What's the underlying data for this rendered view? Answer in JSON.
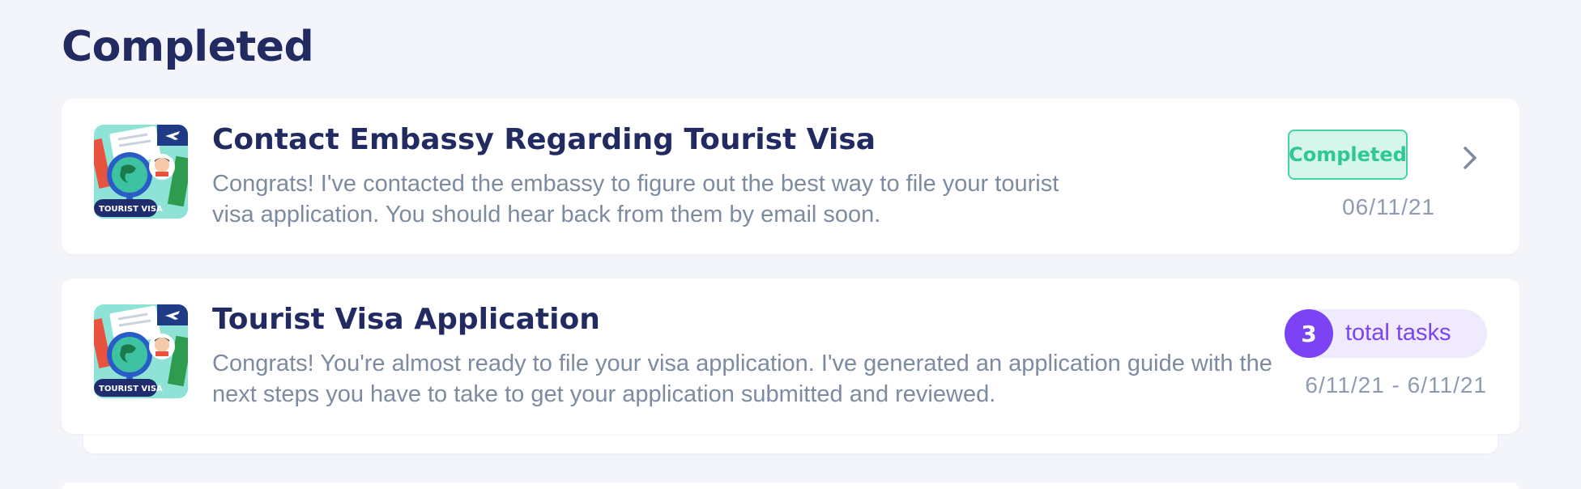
{
  "section": {
    "title": "Completed"
  },
  "cards": [
    {
      "thumbnail_text": "TOURIST VISA",
      "title": "Contact Embassy Regarding Tourist Visa",
      "description": "Congrats! I've contacted the embassy to figure out the best way to file your tourist visa application. You should hear back from them by email soon.",
      "status": "Completed",
      "date": "06/11/21",
      "icon": "chevron-right-icon"
    },
    {
      "thumbnail_text": "TOURIST VISA",
      "title": "Tourist Visa Application",
      "description": "Congrats! You're almost ready to file your visa application. I've generated an application guide with the next steps you have to take to get your application submitted and reviewed.",
      "task_count": "3",
      "task_label": "total tasks",
      "date_range": "6/11/21 - 6/11/21"
    }
  ],
  "colors": {
    "heading": "#222b61",
    "body_text": "#7d8ba0",
    "completed_green": "#2ec796",
    "accent_purple": "#7b43f3",
    "background": "#f3f5fa"
  }
}
